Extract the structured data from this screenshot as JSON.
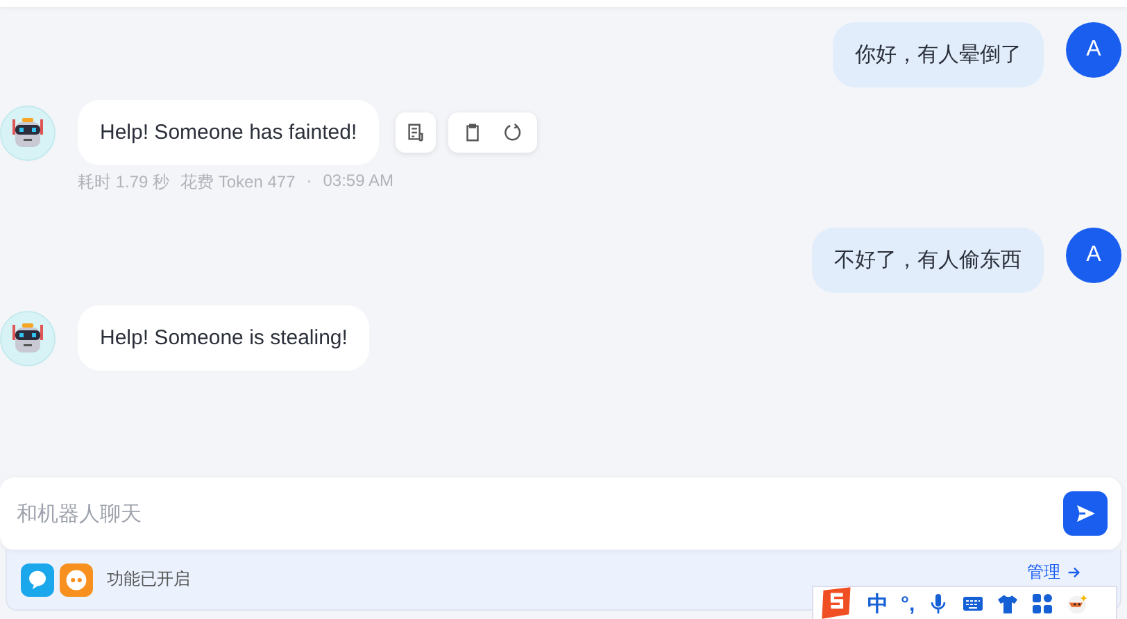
{
  "messages": [
    {
      "kind": "user",
      "avatar": "A",
      "text": "你好，有人晕倒了"
    },
    {
      "kind": "bot",
      "text": "Help! Someone has fainted!",
      "actions": true,
      "meta": [
        "耗时 1.79 秒",
        "花费 Token 477",
        "·",
        "03:59 AM"
      ]
    },
    {
      "kind": "user",
      "avatar": "A",
      "text": "不好了，有人偷东西"
    },
    {
      "kind": "bot",
      "text": "Help! Someone is stealing!",
      "actions": false
    }
  ],
  "composer": {
    "placeholder": "和机器人聊天"
  },
  "features": {
    "status": "功能已开启",
    "manage": "管理"
  },
  "ime": {
    "mode": "中",
    "punct": "°,"
  }
}
